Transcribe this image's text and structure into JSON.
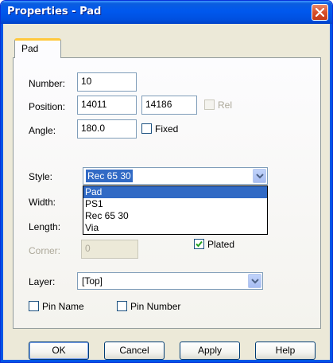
{
  "window": {
    "title": "Properties - Pad"
  },
  "tabs": [
    {
      "label": "Pad",
      "active": true
    }
  ],
  "fields": {
    "number": {
      "label": "Number:",
      "value": "10"
    },
    "position": {
      "label": "Position:",
      "x": "14011",
      "y": "14186",
      "rel_label": "Rel",
      "rel_checked": false,
      "rel_enabled": false
    },
    "angle": {
      "label": "Angle:",
      "value": "180.0",
      "fixed_label": "Fixed",
      "fixed_checked": false
    },
    "style": {
      "label": "Style:",
      "value": "Rec 65 30",
      "options": [
        "Pad",
        "PS1",
        "Rec 65 30",
        "Via"
      ],
      "highlighted": "Pad"
    },
    "width": {
      "label": "Width:"
    },
    "length": {
      "label": "Length:"
    },
    "corner": {
      "label": "Corner:",
      "value": "0",
      "enabled": false
    },
    "plated": {
      "label": "Plated",
      "checked": true
    },
    "layer": {
      "label": "Layer:",
      "value": "[Top]"
    },
    "pin_name": {
      "label": "Pin Name",
      "checked": false
    },
    "pin_number": {
      "label": "Pin Number",
      "checked": false
    }
  },
  "buttons": {
    "ok": "OK",
    "cancel": "Cancel",
    "apply": "Apply",
    "help": "Help"
  },
  "icons": {
    "close": "close-icon",
    "dropdown": "chevron-down-icon",
    "check": "checkmark-icon"
  },
  "colors": {
    "titlebar": "#0058ee",
    "selection": "#316ac5",
    "tab_accent": "#ffc83c"
  }
}
